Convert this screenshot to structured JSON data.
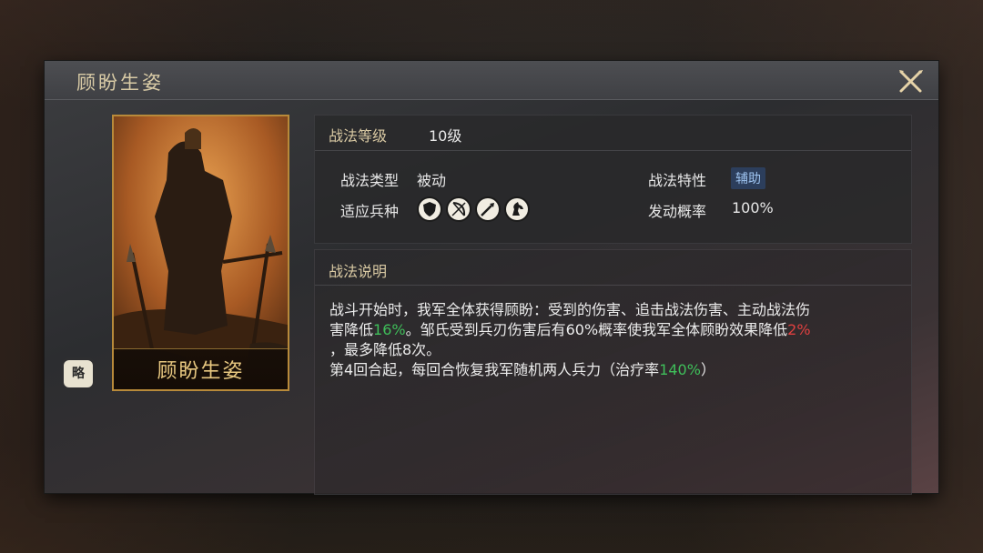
{
  "dialog": {
    "title": "顾盼生姿",
    "close_icon": "close-x-icon"
  },
  "card": {
    "name": "顾盼生姿",
    "badge": "略"
  },
  "info": {
    "level_label": "战法等级",
    "level_value": "10级",
    "type_label": "战法类型",
    "type_value": "被动",
    "trait_label": "战法特性",
    "trait_value": "辅助",
    "units_label": "适应兵种",
    "units": [
      "shield-icon",
      "bow-icon",
      "spear-icon",
      "horse-icon"
    ],
    "chance_label": "发动概率",
    "chance_value": "100%"
  },
  "description": {
    "header": "战法说明",
    "p1": "战斗开始时，我军全体获得顾盼：受到的伤害、追击战法伤害、主动战法伤",
    "p2a": "害降低",
    "p2b": "16%",
    "p2c": "。邹氏受到兵刃伤害后有60%概率使我军全体顾盼效果降低",
    "p2d": "2%",
    "p3": "，最多降低8次。",
    "p4a": "第4回合起，每回合恢复我军随机两人兵力（治疗率",
    "p4b": "140%",
    "p4c": "）"
  },
  "colors": {
    "accent_gold": "#d9c9a3",
    "green": "#3fbf5a",
    "red": "#e04040",
    "tag_blue": "#2c3e5c"
  }
}
